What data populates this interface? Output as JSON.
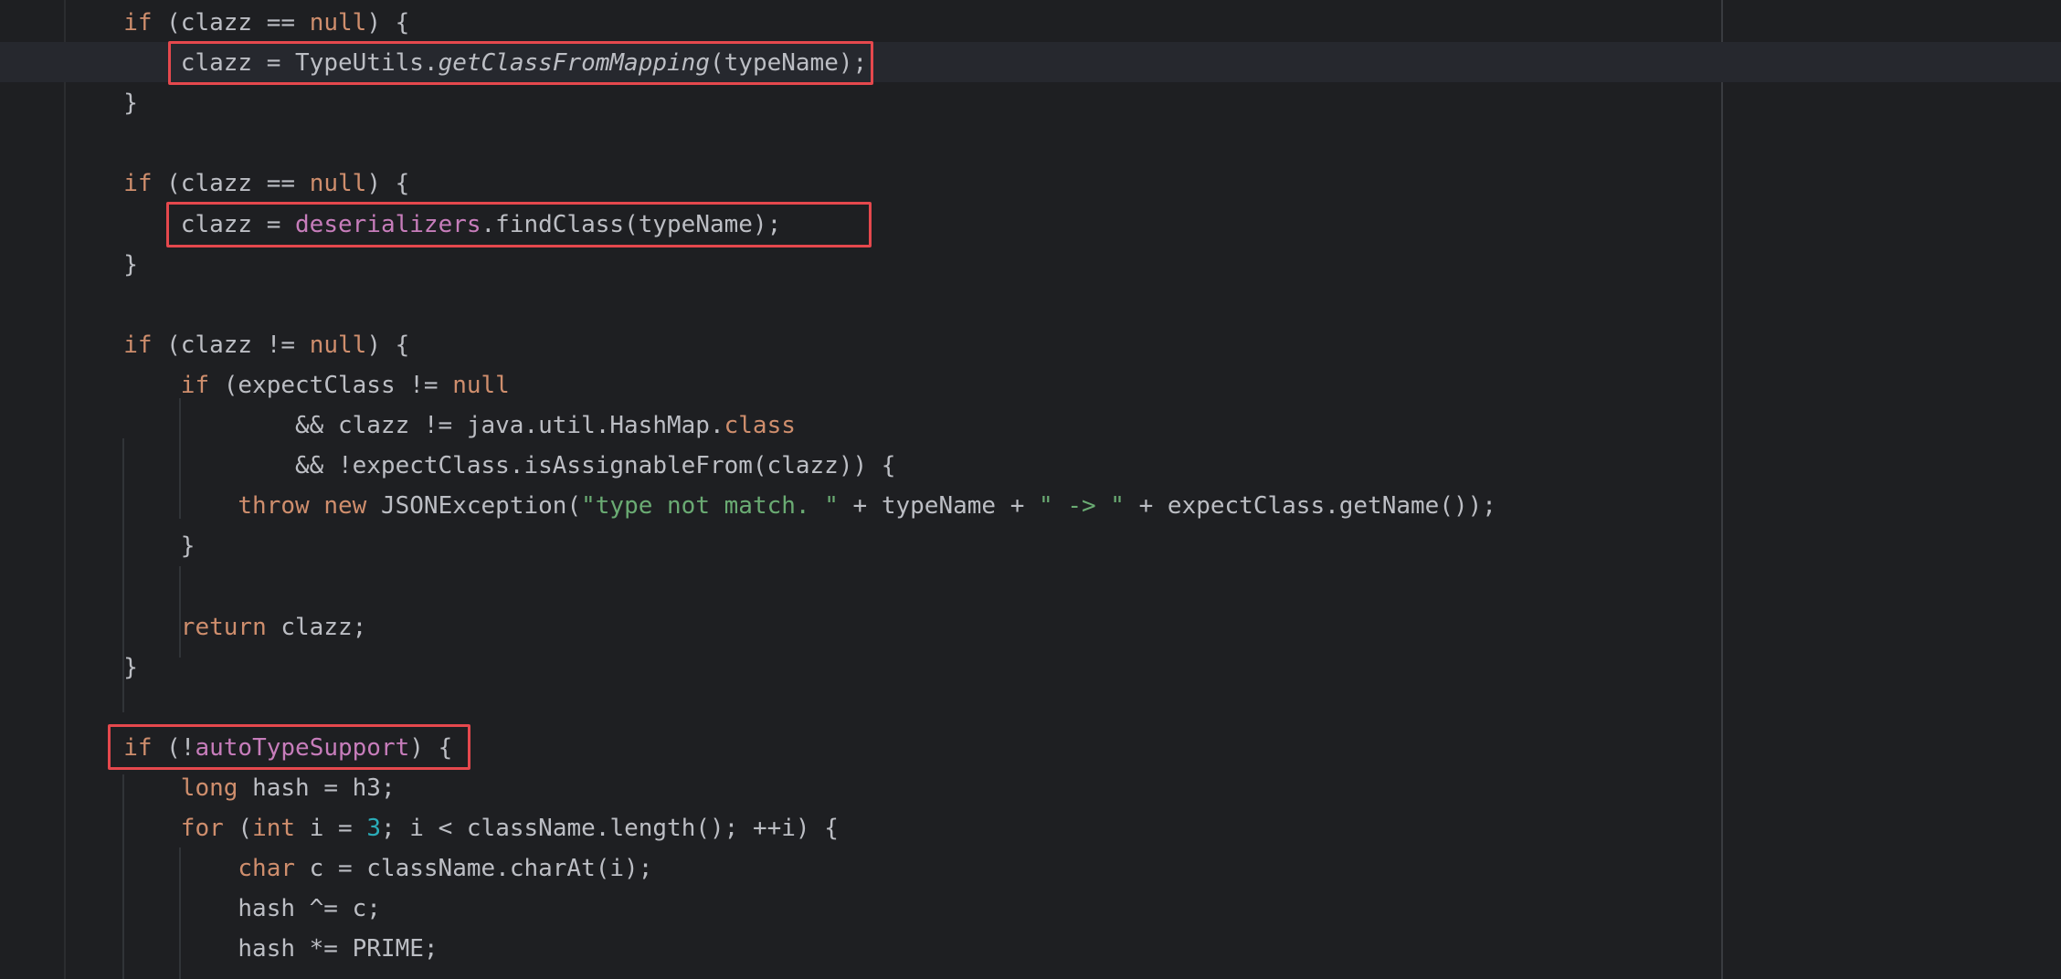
{
  "colors": {
    "background": "#1e1f22",
    "text": "#bcbec4",
    "keyword": "#cf8e6d",
    "field": "#c77dbb",
    "string": "#6aab73",
    "number": "#2aacb8",
    "highlight_box": "#e5484d"
  },
  "lines": [
    {
      "indent": 8,
      "tokens": [
        {
          "t": "if",
          "k": "kw"
        },
        {
          "t": " (clazz == "
        },
        {
          "t": "null",
          "k": "kw"
        },
        {
          "t": ") {"
        }
      ]
    },
    {
      "indent": 12,
      "tokens": [
        {
          "t": "clazz = TypeUtils."
        },
        {
          "t": "getClassFromMapping",
          "k": "it"
        },
        {
          "t": "(typeName);"
        }
      ]
    },
    {
      "indent": 8,
      "tokens": [
        {
          "t": "}"
        }
      ]
    },
    {
      "indent": 0,
      "tokens": []
    },
    {
      "indent": 8,
      "tokens": [
        {
          "t": "if",
          "k": "kw"
        },
        {
          "t": " (clazz == "
        },
        {
          "t": "null",
          "k": "kw"
        },
        {
          "t": ") {"
        }
      ]
    },
    {
      "indent": 12,
      "tokens": [
        {
          "t": "clazz = "
        },
        {
          "t": "deserializers",
          "k": "fld"
        },
        {
          "t": ".findClass(typeName);"
        }
      ]
    },
    {
      "indent": 8,
      "tokens": [
        {
          "t": "}"
        }
      ]
    },
    {
      "indent": 0,
      "tokens": []
    },
    {
      "indent": 8,
      "tokens": [
        {
          "t": "if",
          "k": "kw"
        },
        {
          "t": " (clazz != "
        },
        {
          "t": "null",
          "k": "kw"
        },
        {
          "t": ") {"
        }
      ]
    },
    {
      "indent": 12,
      "tokens": [
        {
          "t": "if",
          "k": "kw"
        },
        {
          "t": " (expectClass != "
        },
        {
          "t": "null",
          "k": "kw"
        }
      ]
    },
    {
      "indent": 20,
      "tokens": [
        {
          "t": "&& clazz != java.util.HashMap."
        },
        {
          "t": "class",
          "k": "kw"
        }
      ]
    },
    {
      "indent": 20,
      "tokens": [
        {
          "t": "&& !expectClass.isAssignableFrom(clazz)) {"
        }
      ]
    },
    {
      "indent": 16,
      "tokens": [
        {
          "t": "throw",
          "k": "kw"
        },
        {
          "t": " "
        },
        {
          "t": "new",
          "k": "kw"
        },
        {
          "t": " JSONException("
        },
        {
          "t": "\"type not match. \"",
          "k": "str"
        },
        {
          "t": " + typeName + "
        },
        {
          "t": "\" -> \"",
          "k": "str"
        },
        {
          "t": " + expectClass.getName());"
        }
      ]
    },
    {
      "indent": 12,
      "tokens": [
        {
          "t": "}"
        }
      ]
    },
    {
      "indent": 0,
      "tokens": []
    },
    {
      "indent": 12,
      "tokens": [
        {
          "t": "return",
          "k": "kw"
        },
        {
          "t": " clazz;"
        }
      ]
    },
    {
      "indent": 8,
      "tokens": [
        {
          "t": "}"
        }
      ]
    },
    {
      "indent": 0,
      "tokens": []
    },
    {
      "indent": 8,
      "tokens": [
        {
          "t": "if",
          "k": "kw"
        },
        {
          "t": " (!"
        },
        {
          "t": "autoTypeSupport",
          "k": "fld"
        },
        {
          "t": ") {"
        }
      ]
    },
    {
      "indent": 12,
      "tokens": [
        {
          "t": "long",
          "k": "kw"
        },
        {
          "t": " hash = h3;"
        }
      ]
    },
    {
      "indent": 12,
      "tokens": [
        {
          "t": "for",
          "k": "kw"
        },
        {
          "t": " ("
        },
        {
          "t": "int",
          "k": "kw"
        },
        {
          "t": " i = "
        },
        {
          "t": "3",
          "k": "num"
        },
        {
          "t": "; i < className.length(); ++i) {"
        }
      ]
    },
    {
      "indent": 16,
      "tokens": [
        {
          "t": "char",
          "k": "kw"
        },
        {
          "t": " c = className.charAt(i);"
        }
      ]
    },
    {
      "indent": 16,
      "tokens": [
        {
          "t": "hash ^= c;"
        }
      ]
    },
    {
      "indent": 16,
      "tokens": [
        {
          "t": "hash *= PRIME;"
        }
      ]
    }
  ]
}
